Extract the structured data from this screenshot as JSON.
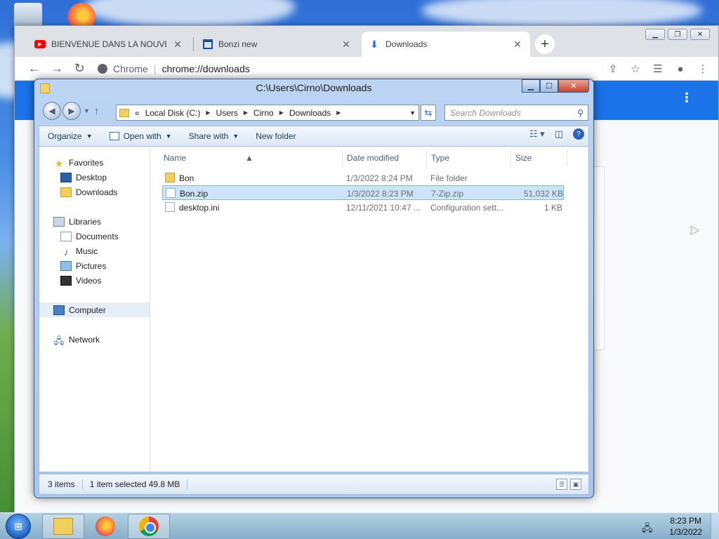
{
  "chrome": {
    "tabs": [
      {
        "title": "BIENVENUE DANS LA NOUVELLE",
        "icon": "youtube-icon"
      },
      {
        "title": "Bonzi new",
        "icon": "page-icon"
      },
      {
        "title": "Downloads",
        "icon": "download-icon"
      }
    ],
    "omnibox": {
      "site_label": "Chrome",
      "url": "chrome://downloads"
    }
  },
  "explorer": {
    "title": "C:\\Users\\Cirno\\Downloads",
    "breadcrumb": {
      "overflow": "«",
      "items": [
        "Local Disk (C:)",
        "Users",
        "Cirno",
        "Downloads"
      ]
    },
    "search_placeholder": "Search Downloads",
    "commands": {
      "organize": "Organize",
      "open_with": "Open with",
      "share_with": "Share with",
      "new_folder": "New folder"
    },
    "navpane": {
      "favorites": "Favorites",
      "desktop": "Desktop",
      "downloads": "Downloads",
      "libraries": "Libraries",
      "documents": "Documents",
      "music": "Music",
      "pictures": "Pictures",
      "videos": "Videos",
      "computer": "Computer",
      "network": "Network"
    },
    "columns": {
      "name": "Name",
      "date": "Date modified",
      "type": "Type",
      "size": "Size"
    },
    "files": [
      {
        "name": "Bon",
        "date": "1/3/2022 8:24 PM",
        "type": "File folder",
        "size": "",
        "icon": "folder-icon",
        "selected": false
      },
      {
        "name": "Bon.zip",
        "date": "1/3/2022 8:23 PM",
        "type": "7-Zip.zip",
        "size": "51,032 KB",
        "icon": "zip-file-icon",
        "selected": true
      },
      {
        "name": "desktop.ini",
        "date": "12/11/2021 10:47 ...",
        "type": "Configuration sett...",
        "size": "1 KB",
        "icon": "config-file-icon",
        "selected": false
      }
    ],
    "status": {
      "count": "3 items",
      "selected": "1 item selected  49.8 MB"
    }
  },
  "taskbar": {
    "time": "8:23 PM",
    "date": "1/3/2022"
  }
}
